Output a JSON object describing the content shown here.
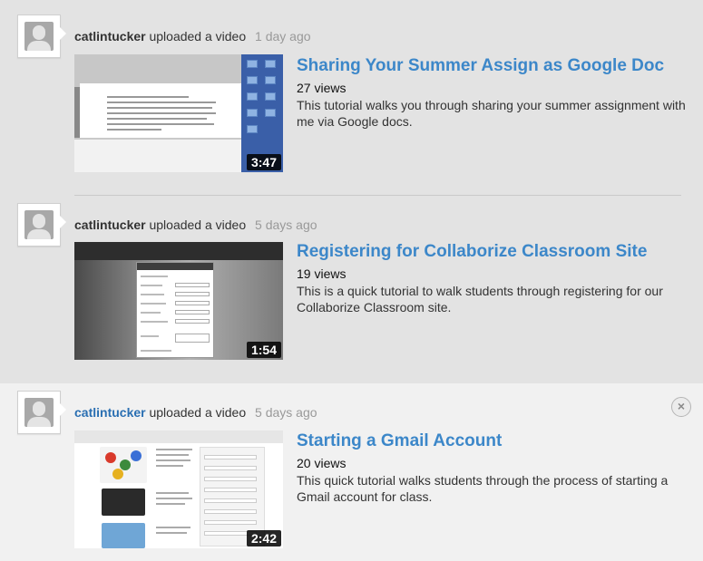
{
  "feed": {
    "items": [
      {
        "user": "catlintucker",
        "action": "uploaded a video",
        "time": "1 day ago",
        "title": "Sharing Your Summer Assign as Google Doc",
        "views": "27 views",
        "description": "This tutorial walks you through sharing your summer assignment with me via Google docs.",
        "duration": "3:47"
      },
      {
        "user": "catlintucker",
        "action": "uploaded a video",
        "time": "5 days ago",
        "title": "Registering for Collaborize Classroom Site",
        "views": "19 views",
        "description": "This is a quick tutorial to walk students through registering for our Collaborize Classroom site.",
        "duration": "1:54"
      },
      {
        "user": "catlintucker",
        "action": "uploaded a video",
        "time": "5 days ago",
        "title": "Starting a Gmail Account",
        "views": "20 views",
        "description": "This quick tutorial walks students through the process of starting a Gmail account for class.",
        "duration": "2:42"
      }
    ],
    "close_label": "×"
  },
  "colors": {
    "link_blue": "#3c87c9",
    "username_link": "#2a6fb2",
    "timestamp_gray": "#999999",
    "background": "#e3e3e3",
    "active_background": "#f1f1f1"
  }
}
